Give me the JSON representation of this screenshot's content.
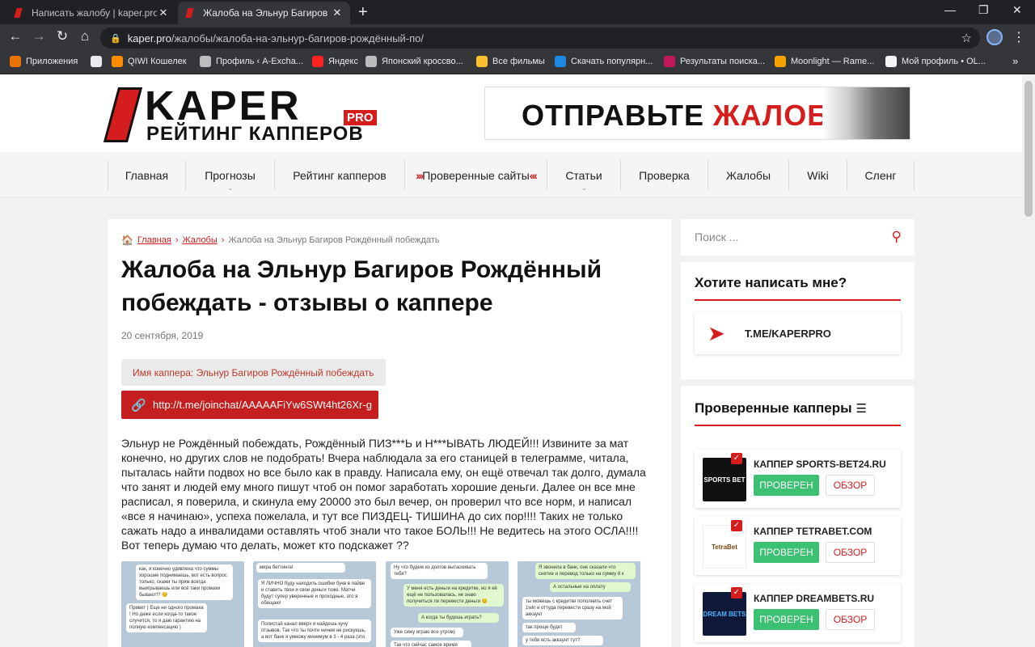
{
  "browser": {
    "tabs": [
      {
        "title": "Написать жалобу | kaper.pro - р",
        "active": false,
        "close": "✕"
      },
      {
        "title": "Жалоба на Эльнур Багиров Рож",
        "active": true,
        "close": "✕"
      }
    ],
    "new_tab": "+",
    "window_controls": {
      "minimize": "—",
      "restore": "❐",
      "close": "✕"
    },
    "nav": {
      "back": "←",
      "forward": "→",
      "reload": "↻",
      "home": "⌂"
    },
    "url_host": "kaper.pro",
    "url_path": "/жалобы/жалоба-на-эльнур-багиров-рождённый-по/",
    "lock_icon": "🔒",
    "bookmark_star": "☆",
    "bookmarks": [
      {
        "label": "Приложения",
        "icon": "apps-grid-icon",
        "color": "#e8710a"
      },
      {
        "label": "",
        "icon": "globe-icon",
        "color": "#e8eaed"
      },
      {
        "label": "QIWI Кошелек",
        "icon": "qiwi-icon",
        "color": "#ff8c00"
      },
      {
        "label": "Профиль ‹ A-Excha...",
        "icon": "mouse-icon",
        "color": "#bdbdbd"
      },
      {
        "label": "Яндекс",
        "icon": "yandex-icon",
        "color": "#f22"
      },
      {
        "label": "Японский кроссво...",
        "icon": "crossword-icon",
        "color": "#bbb"
      },
      {
        "label": "Все фильмы",
        "icon": "film-icon",
        "color": "#fbc02d"
      },
      {
        "label": "Скачать популярн...",
        "icon": "download-icon",
        "color": "#1e88e5"
      },
      {
        "label": "Результаты поиска...",
        "icon": "search-result-icon",
        "color": "#c2185b"
      },
      {
        "label": "Moonlight — Rame...",
        "icon": "moonlight-icon",
        "color": "#f4a300"
      },
      {
        "label": "Мой профиль • OL...",
        "icon": "ok-icon",
        "color": "#f5f5f5"
      }
    ],
    "more_bookmarks": "»"
  },
  "site": {
    "logo": {
      "word1": "KAPER",
      "badge": "PRO",
      "word2": "РЕЙТИНГ КАППЕРОВ"
    },
    "banner": {
      "text_black": "ОТПРАВЬТЕ ",
      "text_red": "ЖАЛОБУ"
    },
    "nav": [
      {
        "label": "Главная",
        "dropdown": false
      },
      {
        "label": "Прогнозы",
        "dropdown": true
      },
      {
        "label": "Рейтинг капперов",
        "dropdown": false
      },
      {
        "label": "Проверенные сайты",
        "dropdown": false,
        "chevrons": true
      },
      {
        "label": "Статьи",
        "dropdown": true
      },
      {
        "label": "Проверка",
        "dropdown": false
      },
      {
        "label": "Жалобы",
        "dropdown": false
      },
      {
        "label": "Wiki",
        "dropdown": false
      },
      {
        "label": "Сленг",
        "dropdown": false
      }
    ],
    "breadcrumbs": {
      "home": "Главная",
      "section": "Жалобы",
      "current": "Жалоба на Эльнур Багиров Рождённый побеждать"
    },
    "title": "Жалоба на Эльнур Багиров Рождённый побеждать - отзывы о каппере",
    "date": "20 сентября, 2019",
    "capper_name": "Имя каппера: Эльнур Багиров Рождённый побеждать",
    "telegram_link": "http://t.me/joinchat/AAAAAFiYw6SWt4ht26Xr-g",
    "body_text": "Эльнур не Рождённый побеждать, Рождённый ПИЗ***Ь и Н***ЫВАТЬ ЛЮДЕЙ!!! Извините за мат конечно, но других слов не подобрать! Вчера наблюдала за его станицей в телеграмме, читала, пыталась найти подвох но все было как в правду. Написала ему, он ещё отвечал так долго, думала что занят и людей ему много пишут чтоб он помог заработать хорошие деньги. Далее он все мне расписал, я поверила, и скинула ему 20000 это был вечер, он проверил что все норм, и написал «все я начинаю», успеха пожелала, и тут все ПИЗДЕЦ- ТИШИНА до сих пор!!!! Таких не только сажать надо а инвалидами оставлять чтоб знали что такое БОЛЬ!!! Не ведитесь на этого ОСЛА!!!!Вот теперь думаю что делать, может кто подскажет ??",
    "screenshots": [
      {
        "bubbles": [
          "как, я конечно удивлена что суммы хорошие поднимаешь, вот есть вопрос только, скажи ты прям всегда выигрываешь или всё таки промахи бывают!? 😊",
          "Привет ) Еще ни одного промаха ! Но даже если когда-то такое случится, то я даю гарантию на полную компенсацию )"
        ]
      },
      {
        "bubbles": [
          "мира беттинга!",
          "Я ЛИЧНО буду находить ошибки букв в лайве и ставить твои и свои деньги тоже. Матчи будут супер уверенные и проходные, это я обещаю!",
          "Полистай канал вверх и найдешь кучу отзывов. Так что ты почти ничем не рискуешь, а вот банк я умножу минимум в 3 - 4 раза (это"
        ]
      },
      {
        "bubbles": [
          "Ну что будем из долгов вытаскивать тебя?",
          "У меня есть деньги на кредитке, но я её ещё не пользовалась, не знаю получиться ли перевести деньги 😊",
          "А когда ты будешь играть?",
          "Уже сижу играю все утром)",
          "Так что сейчас самое время"
        ]
      },
      {
        "bubbles": [
          "Я звонила в банк, оне сказали что снятие и перевод только на сумму 8 к",
          "А остальные на оплату",
          "ты можешь с кредитки пополнить счет 1win и оттуда перевести сразу на мой аккаунт",
          "так проще будет",
          "у тебя есть аккаунт тут?"
        ]
      }
    ]
  },
  "sidebar": {
    "search_placeholder": "Поиск ...",
    "write_title": "Хотите написать мне?",
    "telegram_text": "T.ME/KAPERPRO",
    "verified_title": "Проверенные капперы",
    "verified": [
      {
        "name": "КАППЕР SPORTS-BET24.RU",
        "logo_text": "SPORTS BET",
        "logo_bg": "#111111",
        "logo_color": "#ffffff",
        "btn_verified": "ПРОВЕРЕН",
        "btn_review": "ОБЗОР"
      },
      {
        "name": "КАППЕР TETRABET.COM",
        "logo_text": "TetraBet",
        "logo_bg": "#ffffff",
        "logo_color": "#7a4a14",
        "btn_verified": "ПРОВЕРЕН",
        "btn_review": "ОБЗОР"
      },
      {
        "name": "КАППЕР DREAMBETS.RU",
        "logo_text": "DREAM BETS",
        "logo_bg": "#0f1a3a",
        "logo_color": "#4fb3ff",
        "btn_verified": "ПРОВЕРЕН",
        "btn_review": "ОБЗОР"
      }
    ]
  },
  "colors": {
    "brand_red": "#d61d1d",
    "button_red": "#c41e1e",
    "verified_green": "#3cc173",
    "chrome_dark": "#202124"
  }
}
